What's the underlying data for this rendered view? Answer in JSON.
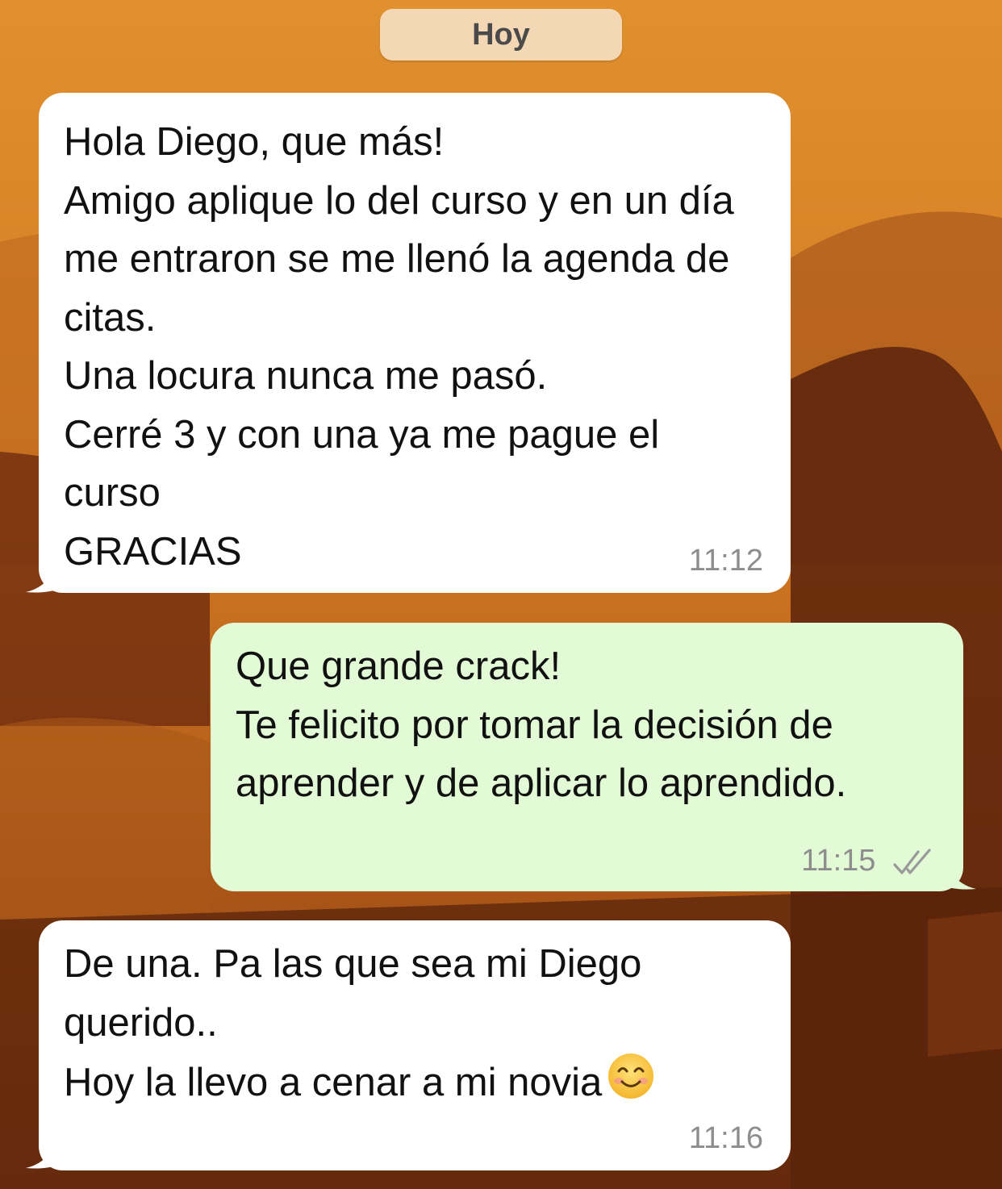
{
  "chat": {
    "date_label": "Hoy",
    "messages": [
      {
        "direction": "incoming",
        "text": "Hola Diego, que más!\nAmigo aplique lo del curso y en un día me entraron se me llenó la agenda de citas.\nUna locura nunca me pasó.\nCerré 3 y con una ya me pague el curso\nGRACIAS",
        "time": "11:12"
      },
      {
        "direction": "outgoing",
        "text": "Que grande crack!\nTe felicito por tomar la decisión de aprender y de aplicar lo aprendido.",
        "time": "11:15",
        "status_icon": "double-check-icon"
      },
      {
        "direction": "incoming",
        "text": "De una. Pa las que sea mi Diego querido..\nHoy la llevo a cenar a mi novia",
        "emoji": "smiling-face-emoji",
        "time": "11:16"
      }
    ]
  },
  "colors": {
    "incoming_bubble": "#ffffff",
    "outgoing_bubble": "#e2fbd6",
    "date_pill": "#f4d7b5",
    "timestamp": "#8d8d8d"
  }
}
